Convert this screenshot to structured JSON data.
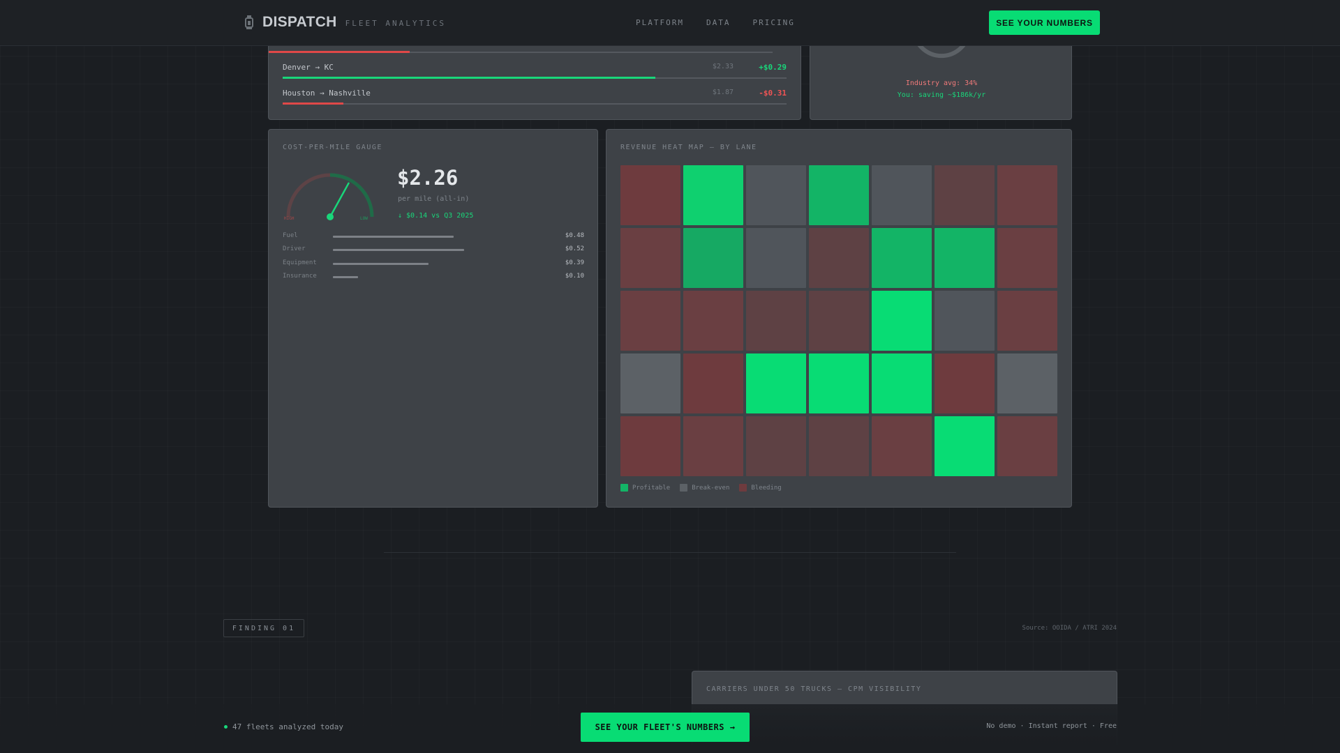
{
  "nav": {
    "brand_name": "DISPATCH",
    "brand_tag": "FLEET ANALYTICS",
    "brand_icon": "lantern-icon",
    "links": [
      "PLATFORM",
      "DATA",
      "PRICING"
    ],
    "cta": "SEE YOUR NUMBERS"
  },
  "lanes": {
    "rows": [
      {
        "name": "Denver → KC",
        "cpm": "$2.33",
        "delta": "+$0.29",
        "status": "positive",
        "fill": 0.74
      },
      {
        "name": "Houston → Nashville",
        "cpm": "$1.87",
        "delta": "-$0.31",
        "status": "negative",
        "fill": 0.12
      }
    ],
    "partial_bar_fill": 0.28
  },
  "churn": {
    "industry": "Industry avg: 34%",
    "saving": "You: saving ~$186k/yr"
  },
  "gauge": {
    "title": "COST-PER-MILE GAUGE",
    "value": "$2.26",
    "sub": "per mile (all-in)",
    "change": "↓ $0.14 vs Q3 2025",
    "label_high": "HIGH",
    "label_low": "LOW",
    "needle_fraction": 0.66,
    "breakdown": [
      {
        "label": "Fuel",
        "value": "$0.48",
        "fill": 0.48
      },
      {
        "label": "Driver",
        "value": "$0.52",
        "fill": 0.52
      },
      {
        "label": "Equipment",
        "value": "$0.39",
        "fill": 0.38
      },
      {
        "label": "Insurance",
        "value": "$0.10",
        "fill": 0.1
      }
    ]
  },
  "heatmap": {
    "title": "REVENUE HEAT MAP — BY LANE",
    "colors": {
      "profit": [
        "#16a963",
        "#13b466",
        "#0fd06f",
        "#08dc74"
      ],
      "even": [
        "#50555b",
        "#5c6166"
      ],
      "bleed": [
        "#5e4144",
        "#6a3f42",
        "#6e3b3e"
      ]
    },
    "cells": [
      [
        "b2",
        "p2",
        "e0",
        "p1",
        "e0",
        "b0",
        "b1"
      ],
      [
        "b1",
        "p0",
        "e0",
        "b0",
        "p1",
        "p1",
        "b1"
      ],
      [
        "b1",
        "b1",
        "b0",
        "b0",
        "p3",
        "e0",
        "b1"
      ],
      [
        "e1",
        "b2",
        "p3",
        "p3",
        "p3",
        "b2",
        "e1"
      ],
      [
        "b2",
        "b1",
        "b0",
        "b0",
        "b1",
        "p3",
        "b1"
      ]
    ],
    "legend": [
      "Profitable",
      "Break-even",
      "Bleeding"
    ]
  },
  "finding": {
    "badge": "FINDING 01",
    "source": "Source: OOIDA / ATRI 2024",
    "carriers_title": "CARRIERS UNDER 50 TRUCKS — CPM VISIBILITY"
  },
  "footer": {
    "live": "47 fleets analyzed today",
    "cta": "SEE YOUR FLEET'S NUMBERS →",
    "note": "No demo · Instant report · Free"
  }
}
